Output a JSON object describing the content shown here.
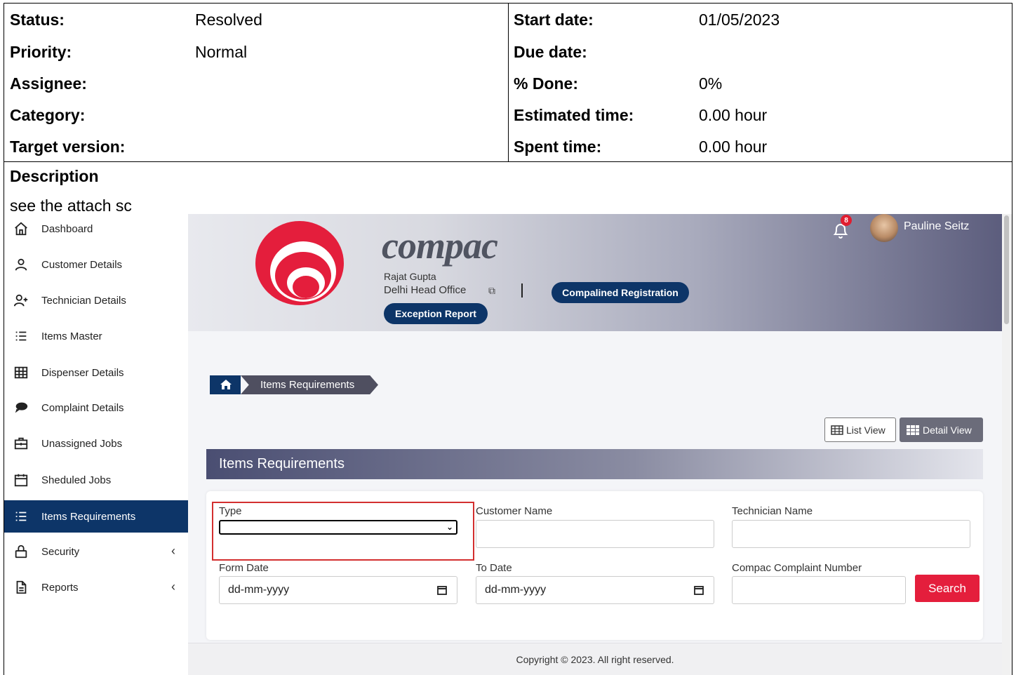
{
  "issue": {
    "left": [
      {
        "label": "Status:",
        "value": "Resolved"
      },
      {
        "label": "Priority:",
        "value": "Normal"
      },
      {
        "label": "Assignee:",
        "value": ""
      },
      {
        "label": "Category:",
        "value": ""
      },
      {
        "label": "Target version:",
        "value": ""
      }
    ],
    "right": [
      {
        "label": "Start date:",
        "value": "01/05/2023"
      },
      {
        "label": "Due date:",
        "value": ""
      },
      {
        "label": "% Done:",
        "value": "0%"
      },
      {
        "label": "Estimated time:",
        "value": "0.00 hour"
      },
      {
        "label": "Spent time:",
        "value": "0.00 hour"
      }
    ]
  },
  "description": {
    "title": "Description",
    "text": "see the attach sc"
  },
  "app": {
    "sidebar": {
      "items": [
        {
          "label": "Dashboard",
          "icon": "home-icon"
        },
        {
          "label": "Customer Details",
          "icon": "user-icon"
        },
        {
          "label": "Technician Details",
          "icon": "user-plus-icon"
        },
        {
          "label": "Items Master",
          "icon": "list-icon"
        },
        {
          "label": "Dispenser Details",
          "icon": "grid-icon"
        },
        {
          "label": "Complaint Details",
          "icon": "chat-icon"
        },
        {
          "label": "Unassigned Jobs",
          "icon": "briefcase-icon"
        },
        {
          "label": "Sheduled Jobs",
          "icon": "calendar-icon"
        },
        {
          "label": "Items Requirements",
          "icon": "list-icon",
          "active": true
        },
        {
          "label": "Security",
          "icon": "lock-icon",
          "chevron": "‹"
        },
        {
          "label": "Reports",
          "icon": "document-icon",
          "chevron": "‹"
        }
      ]
    },
    "header": {
      "brand": "compac",
      "user_small": "Rajat Gupta",
      "office": "Delhi Head Office",
      "registration_button": "Compalined Registration",
      "exception_button": "Exception Report",
      "notification_count": "8",
      "user_name": "Pauline Seitz"
    },
    "breadcrumb": {
      "page": "Items Requirements"
    },
    "views": {
      "list": "List View",
      "detail": "Detail View"
    },
    "card": {
      "title": "Items Requirements",
      "fields": {
        "type_label": "Type",
        "customer_label": "Customer Name",
        "technician_label": "Technician Name",
        "from_date_label": "Form Date",
        "from_date_placeholder": "dd-mm-yyyy",
        "to_date_label": "To Date",
        "to_date_placeholder": "dd-mm-yyyy",
        "complaint_label": "Compac Complaint Number"
      },
      "search_button": "Search"
    },
    "footer": "Copyright © 2023. All right reserved.",
    "colors": {
      "primary_navy": "#0d3568",
      "accent_red": "#e41e3c",
      "highlight_red": "#d32f2f"
    }
  }
}
